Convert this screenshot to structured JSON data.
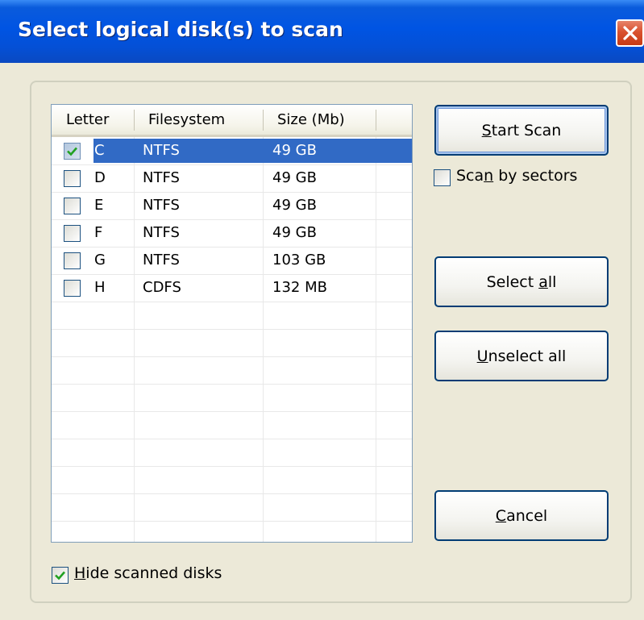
{
  "window": {
    "title": "Select logical disk(s) to scan"
  },
  "list": {
    "columns": [
      "Letter",
      "Filesystem",
      "Size (Mb)"
    ],
    "rows": [
      {
        "checked": true,
        "letter": "C",
        "filesystem": "NTFS",
        "size": "49 GB",
        "selected": true
      },
      {
        "checked": false,
        "letter": "D",
        "filesystem": "NTFS",
        "size": "49 GB",
        "selected": false
      },
      {
        "checked": false,
        "letter": "E",
        "filesystem": "NTFS",
        "size": "49 GB",
        "selected": false
      },
      {
        "checked": false,
        "letter": "F",
        "filesystem": "NTFS",
        "size": "49 GB",
        "selected": false
      },
      {
        "checked": false,
        "letter": "G",
        "filesystem": "NTFS",
        "size": "103 GB",
        "selected": false
      },
      {
        "checked": false,
        "letter": "H",
        "filesystem": "CDFS",
        "size": "132 MB",
        "selected": false
      }
    ]
  },
  "buttons": {
    "start_scan": {
      "mnemonic": "S",
      "rest": "tart Scan"
    },
    "select_all": {
      "pre": "Select ",
      "mnemonic": "a",
      "rest": "ll"
    },
    "unselect_all": {
      "mnemonic": "U",
      "rest": "nselect all"
    },
    "cancel": {
      "mnemonic": "C",
      "rest": "ancel"
    }
  },
  "options": {
    "scan_by_sectors": {
      "pre": "Sca",
      "mnemonic": "n",
      "rest": " by sectors",
      "checked": false
    },
    "hide_scanned": {
      "mnemonic": "H",
      "rest": "ide scanned disks",
      "checked": true
    }
  },
  "colors": {
    "title_bar": "#0054e3",
    "selection": "#316ac5",
    "dialog_bg": "#ece9d8",
    "check_green": "#21a121"
  }
}
